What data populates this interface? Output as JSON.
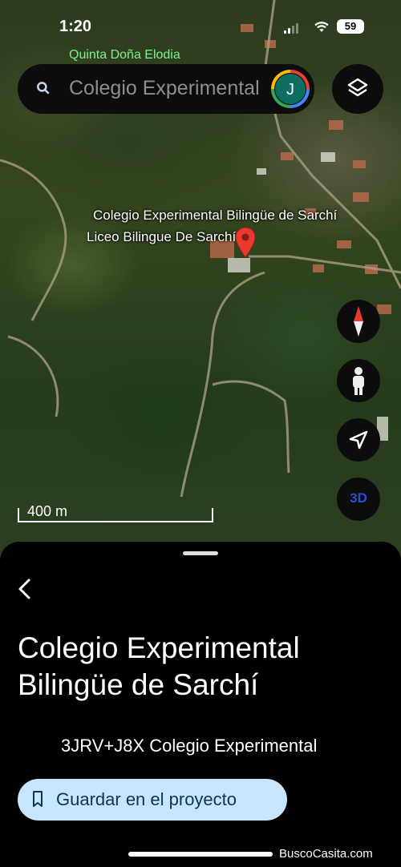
{
  "status_bar": {
    "time": "1:20",
    "battery": "59"
  },
  "map": {
    "nearby_place": "Quinta Doña Elodia",
    "place_label_primary": "Colegio Experimental Bilingüe de Sarchí",
    "place_label_secondary": "Liceo Bilingue De Sarchí",
    "scale_label": "400 m",
    "btn_3d": "3D"
  },
  "search": {
    "value": "Colegio Experimental",
    "avatar_initial": "J"
  },
  "sheet": {
    "title": "Colegio Experimental Bilingüe de Sarchí",
    "address": "3JRV+J8X Colegio Experimental",
    "save_label": "Guardar en el proyecto"
  },
  "watermark": "BuscoCasita.com",
  "colors": {
    "accent_save_bg": "#c9e5fc",
    "pin": "#e8392f",
    "nearby_label": "#7ff08a"
  }
}
